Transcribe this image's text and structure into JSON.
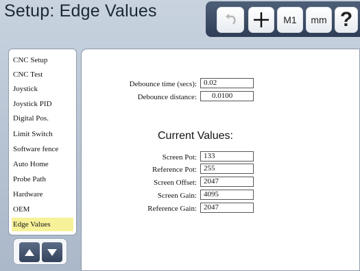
{
  "header": {
    "title": "Setup: Edge Values"
  },
  "toolbar": {
    "undo_icon": "undo-arrow-icon",
    "plus_icon": "crosshair-plus-icon",
    "m1_label": "M1",
    "mm_label": "mm",
    "help_label": "?"
  },
  "sidebar": {
    "items": [
      {
        "label": "CNC Setup"
      },
      {
        "label": "CNC Test"
      },
      {
        "label": "Joystick"
      },
      {
        "label": "Joystick PID"
      },
      {
        "label": "Digital Pos."
      },
      {
        "label": "Limit Switch"
      },
      {
        "label": "Software fence"
      },
      {
        "label": "Auto Home"
      },
      {
        "label": "Probe Path"
      },
      {
        "label": "Hardware"
      },
      {
        "label": "OEM"
      },
      {
        "label": "Edge Values",
        "active": true
      }
    ],
    "up_icon": "arrow-up-icon",
    "down_icon": "arrow-down-icon"
  },
  "settings": {
    "debounce_time_label": "Debounce time (secs):",
    "debounce_time_value": "0.02",
    "debounce_distance_label": "Debounce distance:",
    "debounce_distance_value": "0.0100"
  },
  "current_values": {
    "heading": "Current Values:",
    "screen_pot_label": "Screen Pot:",
    "screen_pot_value": "133",
    "reference_pot_label": "Reference Pot:",
    "reference_pot_value": "255",
    "screen_offset_label": "Screen Offset:",
    "screen_offset_value": "2047",
    "screen_gain_label": "Screen Gain:",
    "screen_gain_value": "4095",
    "reference_gain_label": "Reference Gain:",
    "reference_gain_value": "2047"
  },
  "colors": {
    "toolbar_bg": "#2f3e56",
    "active_item": "#f7f29a",
    "screen_bg": "#bcc8d7"
  }
}
